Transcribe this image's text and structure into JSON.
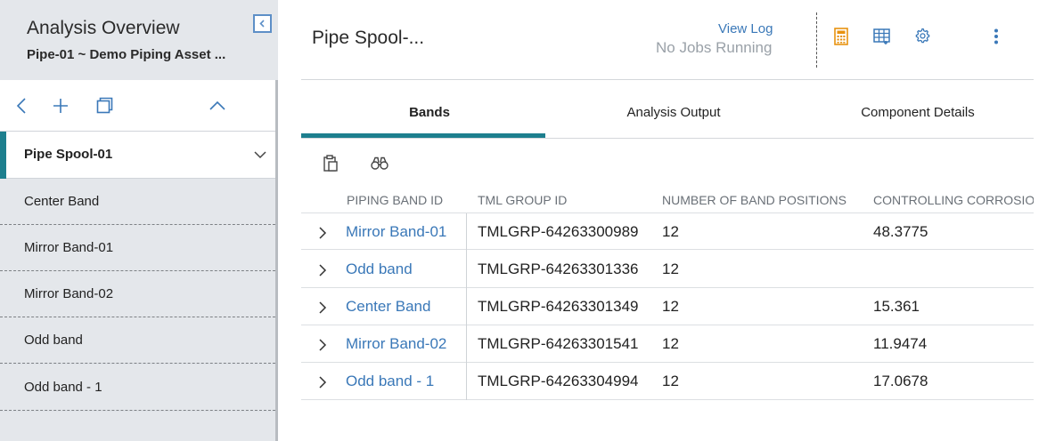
{
  "sidebar": {
    "title": "Analysis Overview",
    "subtitle": "Pipe-01 ~ Demo Piping Asset ...",
    "spool_label": "Pipe Spool-01",
    "items": [
      {
        "label": "Center Band"
      },
      {
        "label": "Mirror Band-01"
      },
      {
        "label": "Mirror Band-02"
      },
      {
        "label": "Odd band"
      },
      {
        "label": "Odd band - 1"
      }
    ]
  },
  "header": {
    "title": "Pipe Spool-...",
    "view_log": "View Log",
    "job_status": "No Jobs Running"
  },
  "tabs": [
    {
      "label": "Bands"
    },
    {
      "label": "Analysis Output"
    },
    {
      "label": "Component Details"
    }
  ],
  "table": {
    "columns": [
      "PIPING BAND ID",
      "TML GROUP ID",
      "NUMBER OF BAND POSITIONS",
      "CONTROLLING CORROSION I"
    ],
    "rows": [
      {
        "band_id": "Mirror Band-01",
        "tml_group": "TMLGRP-64263300989",
        "positions": "12",
        "corrosion": "48.3775"
      },
      {
        "band_id": "Odd band",
        "tml_group": "TMLGRP-64263301336",
        "positions": "12",
        "corrosion": ""
      },
      {
        "band_id": "Center Band",
        "tml_group": "TMLGRP-64263301349",
        "positions": "12",
        "corrosion": "15.361"
      },
      {
        "band_id": "Mirror Band-02",
        "tml_group": "TMLGRP-64263301541",
        "positions": "12",
        "corrosion": "11.9474"
      },
      {
        "band_id": "Odd band - 1",
        "tml_group": "TMLGRP-64263304994",
        "positions": "12",
        "corrosion": "17.0678"
      }
    ]
  },
  "colors": {
    "accent": "#1d7f8e",
    "link": "#3a78b8",
    "calculator_icon": "#e8920f",
    "toolbar_icon": "#3a78b8"
  },
  "icons": {
    "collapse": "collapse-sidebar-icon",
    "back": "chevron-left-icon",
    "add": "plus-icon",
    "copy": "copy-icon",
    "collapse_up": "chevron-up-icon",
    "expand": "chevron-down-icon",
    "calculator": "calculator-icon",
    "grid": "table-grid-icon",
    "settings": "gear-icon",
    "more": "kebab-menu-icon",
    "paste": "clipboard-icon",
    "find": "binoculars-icon",
    "row_expand": "chevron-right-icon"
  }
}
